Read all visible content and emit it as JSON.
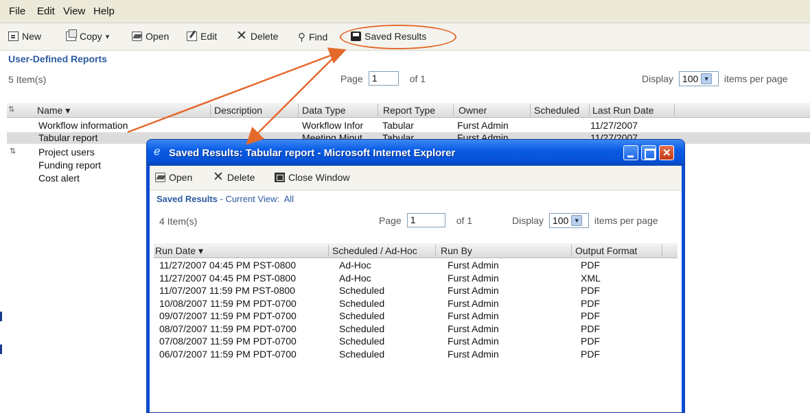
{
  "menu": [
    "File",
    "Edit",
    "View",
    "Help"
  ],
  "toolbar": {
    "new": "New",
    "copy": "Copy",
    "open": "Open",
    "edit": "Edit",
    "delete": "Delete",
    "find": "Find",
    "saved_results": "Saved Results"
  },
  "reports": {
    "title": "User-Defined Reports",
    "item_count": "5 Item(s)",
    "page_label": "Page",
    "page_value": "1",
    "page_of": "of 1",
    "display_label": "Display",
    "display_value": "100",
    "per_page": "items per page",
    "columns": [
      "Name",
      "Description",
      "Data Type",
      "Report Type",
      "Owner",
      "Scheduled",
      "Last Run Date"
    ],
    "rows": [
      {
        "name": "Workflow information",
        "data_type": "Workflow Infor",
        "report_type": "Tabular",
        "owner": "Furst Admin",
        "last_run": "11/27/2007"
      },
      {
        "name": "Tabular report",
        "data_type": "Meeting Minut",
        "report_type": "Tabular",
        "owner": "Furst Admin",
        "last_run": "11/27/2007"
      },
      {
        "name": "Project users"
      },
      {
        "name": "Funding report"
      },
      {
        "name": "Cost alert"
      }
    ]
  },
  "popup": {
    "title": "Saved Results: Tabular report - Microsoft Internet Explorer",
    "toolbar": {
      "open": "Open",
      "delete": "Delete",
      "close": "Close Window"
    },
    "heading": "Saved Results",
    "current_view": "- Current View:",
    "view_value": "All",
    "item_count": "4 Item(s)",
    "page_label": "Page",
    "page_value": "1",
    "page_of": "of 1",
    "display_label": "Display",
    "display_value": "100",
    "per_page": "items per page",
    "columns": [
      "Run Date",
      "Scheduled / Ad-Hoc",
      "Run By",
      "Output Format"
    ],
    "rows": [
      [
        "11/27/2007 04:45 PM PST-0800",
        "Ad-Hoc",
        "Furst Admin",
        "PDF"
      ],
      [
        "11/27/2007 04:45 PM PST-0800",
        "Ad-Hoc",
        "Furst Admin",
        "XML"
      ],
      [
        "11/07/2007 11:59 PM PST-0800",
        "Scheduled",
        "Furst Admin",
        "PDF"
      ],
      [
        "10/08/2007 11:59 PM PDT-0700",
        "Scheduled",
        "Furst Admin",
        "PDF"
      ],
      [
        "09/07/2007 11:59 PM PDT-0700",
        "Scheduled",
        "Furst Admin",
        "PDF"
      ],
      [
        "08/07/2007 11:59 PM PDT-0700",
        "Scheduled",
        "Furst Admin",
        "PDF"
      ],
      [
        "07/08/2007 11:59 PM PDT-0700",
        "Scheduled",
        "Furst Admin",
        "PDF"
      ],
      [
        "06/07/2007 11:59 PM PDT-0700",
        "Scheduled",
        "Furst Admin",
        "PDF"
      ]
    ]
  },
  "colors": {
    "title_blue": "#2b5aa0",
    "annotation_orange": "#e3692b",
    "xp_title_blue": "#0a5ce5"
  }
}
